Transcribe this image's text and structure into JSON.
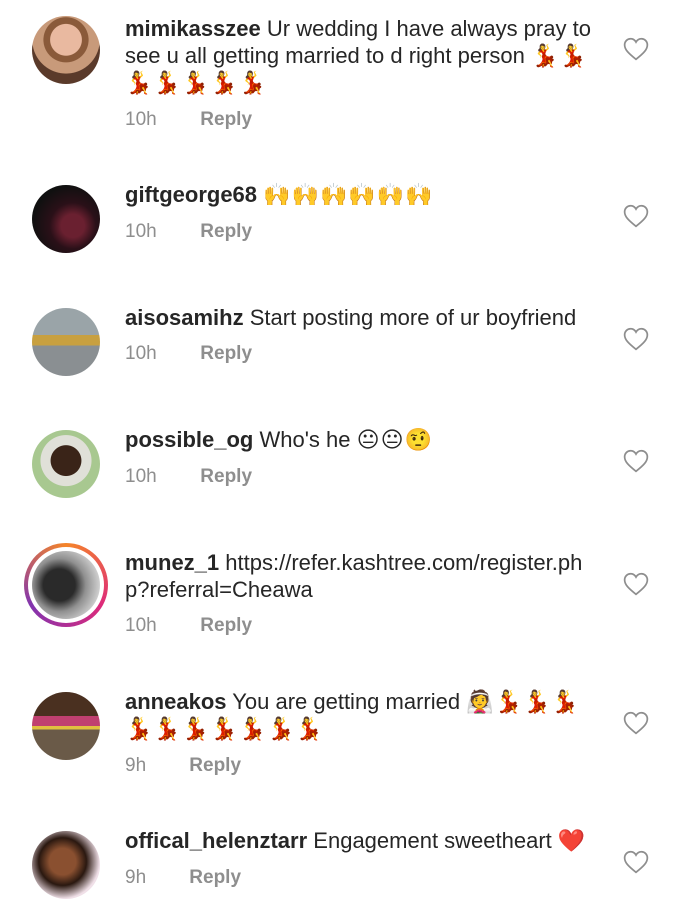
{
  "comments": [
    {
      "username": "mimikasszee",
      "text": "Ur wedding I have always pray to see u all getting married to d right person",
      "emoji": "💃💃💃💃💃💃💃",
      "time": "10h",
      "reply": "Reply"
    },
    {
      "username": "giftgeorge68",
      "text": "",
      "emoji": "🙌🙌🙌🙌🙌🙌",
      "time": "10h",
      "reply": "Reply"
    },
    {
      "username": "aisosamihz",
      "text": "Start posting more of ur boyfriend",
      "emoji": "",
      "time": "10h",
      "reply": "Reply"
    },
    {
      "username": "possible_og",
      "text": "Who's he",
      "emoji": "😐😐🤨",
      "time": "10h",
      "reply": "Reply"
    },
    {
      "username": "munez_1",
      "text": "https://refer.kashtree.com/register.php?referral=Cheawa",
      "emoji": "",
      "time": "10h",
      "reply": "Reply"
    },
    {
      "username": "anneakos",
      "text": "You are getting married",
      "emoji": "👰💃💃💃💃💃💃💃💃💃💃",
      "time": "9h",
      "reply": "Reply"
    },
    {
      "username": "offical_helenztarr",
      "text": "Engagement sweetheart",
      "emoji": "❤️",
      "time": "9h",
      "reply": "Reply"
    }
  ],
  "icons": {
    "like": "heart-outline-icon"
  },
  "colors": {
    "username": "#262626",
    "meta": "#8e8e8e",
    "story_ring": "#dd2a7b",
    "heart": "#8e8e8e"
  }
}
